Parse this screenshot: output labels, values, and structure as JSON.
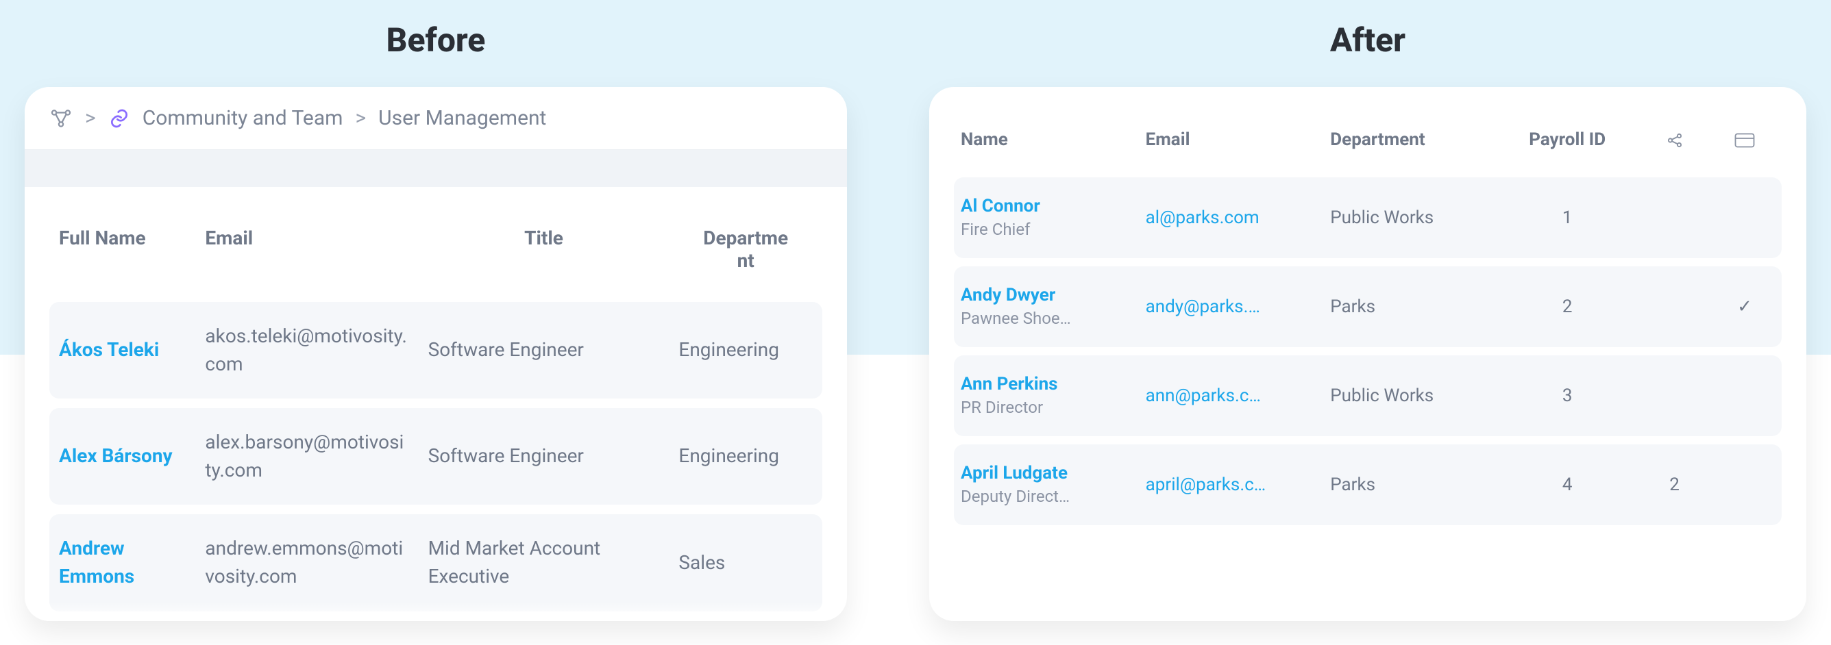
{
  "labels": {
    "before": "Before",
    "after": "After"
  },
  "before": {
    "breadcrumb": {
      "link_label": "Community and Team",
      "current": "User Management"
    },
    "columns": {
      "name": "Full Name",
      "email": "Email",
      "title": "Title",
      "department": "Departme\nnt"
    },
    "rows": [
      {
        "name": "Ákos Teleki",
        "email": "akos.teleki@motivosity.com",
        "title": "Software Engineer",
        "department": "Engineering"
      },
      {
        "name": "Alex Bársony",
        "email": "alex.barsony@motivosity.com",
        "title": "Software Engineer",
        "department": "Engineering"
      },
      {
        "name": "Andrew Emmons",
        "email": "andrew.emmons@motivosity.com",
        "title": "Mid Market Account Executive",
        "department": "Sales"
      }
    ]
  },
  "after": {
    "columns": {
      "name": "Name",
      "email": "Email",
      "department": "Department",
      "payroll_id": "Payroll ID"
    },
    "rows": [
      {
        "name": "Al Connor",
        "subtitle": "Fire Chief",
        "email": "al@parks.com",
        "department": "Public Works",
        "payroll_id": "1",
        "share": "",
        "card": ""
      },
      {
        "name": "Andy Dwyer",
        "subtitle": "Pawnee Shoe…",
        "email": "andy@parks.…",
        "department": "Parks",
        "payroll_id": "2",
        "share": "",
        "card": "✓"
      },
      {
        "name": "Ann Perkins",
        "subtitle": "PR Director",
        "email": "ann@parks.c…",
        "department": "Public Works",
        "payroll_id": "3",
        "share": "",
        "card": ""
      },
      {
        "name": "April Ludgate",
        "subtitle": "Deputy Direct…",
        "email": "april@parks.c…",
        "department": "Parks",
        "payroll_id": "4",
        "share": "2",
        "card": ""
      }
    ]
  }
}
